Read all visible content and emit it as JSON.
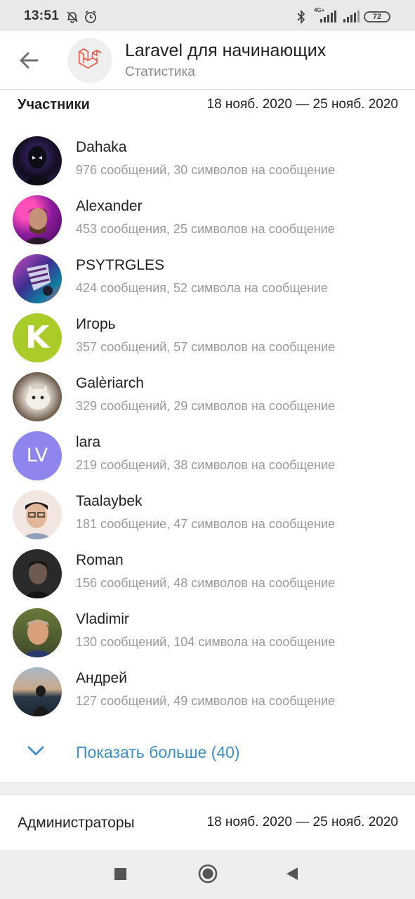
{
  "status_bar": {
    "time": "13:51",
    "battery": "72",
    "network": "4G+",
    "icons": [
      "mute-bell-icon",
      "alarm-icon",
      "bluetooth-icon",
      "signal-icon",
      "signal-icon",
      "battery-icon"
    ]
  },
  "app_bar": {
    "back_icon": "arrow-left-icon",
    "title": "Laravel для начинающих",
    "subtitle": "Статистика",
    "accent": "#f05340"
  },
  "participants": {
    "title": "Участники",
    "range": "18 нояб. 2020 — 25 нояб. 2020",
    "members": [
      {
        "name": "Dahaka",
        "stats": "976 сообщений, 30 символов на сообщение"
      },
      {
        "name": "Alexander",
        "stats": "453 сообщения, 25 символов на сообщение"
      },
      {
        "name": "PSYTRGLES",
        "stats": "424 сообщения, 52 символа на сообщение"
      },
      {
        "name": "Игорь",
        "stats": "357 сообщений, 57 символов на сообщение",
        "initials": "K",
        "color": "#a9cc28"
      },
      {
        "name": "Galèriarch",
        "stats": "329 сообщений, 29 символов на сообщение"
      },
      {
        "name": "lara",
        "stats": "219 сообщений, 38 символов на сообщение",
        "initials": "LV",
        "color": "#8e85ee"
      },
      {
        "name": "Taalaybek",
        "stats": "181 сообщение, 47 символов на сообщение"
      },
      {
        "name": "Roman",
        "stats": "156 сообщений, 48 символов на сообщение"
      },
      {
        "name": "Vladimir",
        "stats": "130 сообщений, 104 символа на сообщение"
      },
      {
        "name": "Андрей",
        "stats": "127 сообщений, 49 символов на сообщение"
      }
    ],
    "show_more": "Показать больше (40)",
    "link_color": "#3d8fc9"
  },
  "admins": {
    "title": "Администраторы",
    "range": "18 нояб. 2020 — 25 нояб. 2020"
  },
  "nav_bar": {
    "icons": [
      "recents-square-icon",
      "home-circle-icon",
      "back-triangle-icon"
    ]
  }
}
